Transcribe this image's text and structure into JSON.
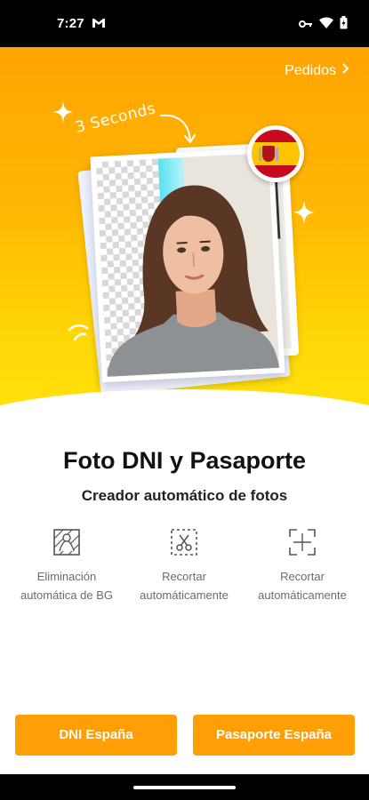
{
  "status_bar": {
    "time": "7:27"
  },
  "header": {
    "orders_link": "Pedidos"
  },
  "hero": {
    "hint": "3 Seconds"
  },
  "main": {
    "title": "Foto DNI y Pasaporte",
    "subtitle": "Creador automático de fotos",
    "features": [
      {
        "icon": "background-removal-icon",
        "label": "Eliminación automática de BG"
      },
      {
        "icon": "scissors-crop-icon",
        "label": "Recortar automáticamente"
      },
      {
        "icon": "crop-frame-icon",
        "label": "Recortar automáticamente"
      }
    ]
  },
  "buttons": {
    "dni": "DNI España",
    "passport": "Pasaporte España"
  },
  "colors": {
    "accent": "#ff9f05",
    "hero_top": "#ffa303",
    "hero_bottom": "#ffe10a"
  }
}
